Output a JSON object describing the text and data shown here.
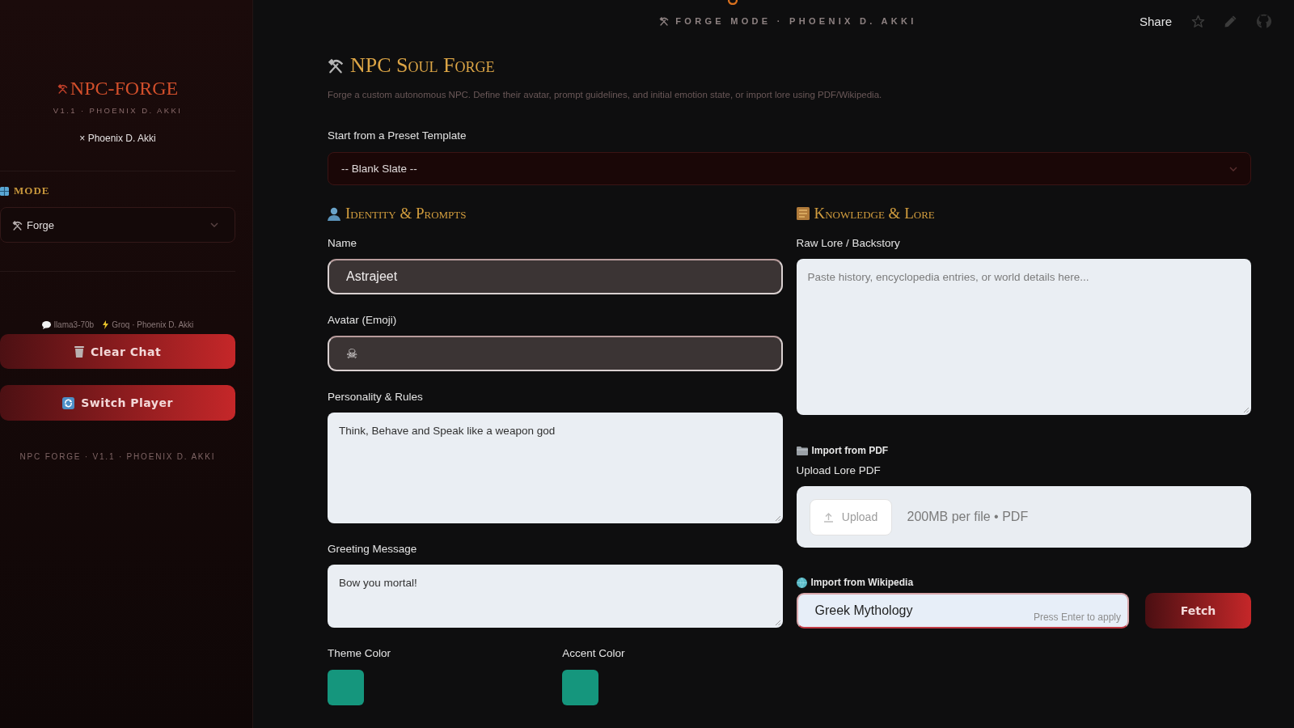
{
  "sidebar": {
    "logo": "NPC-FORGE",
    "version": "V1.1 · PHOENIX D. AKKI",
    "author": "× Phoenix D. Akki",
    "mode": {
      "label": "MODE",
      "value": "Forge"
    },
    "engine_note": {
      "model": "llama3-70b",
      "provider": "Groq · Phoenix D. Akki"
    },
    "buttons": [
      {
        "label": "Clear Chat"
      },
      {
        "label": "Switch Player"
      }
    ],
    "footer": "NPC FORGE · V1.1 · PHOENIX D. AKKI"
  },
  "header": {
    "banner": "FORGE MODE · PHOENIX D. AKKI",
    "share": "Share"
  },
  "forge": {
    "title": "NPC Soul Forge",
    "description": "Forge a custom autonomous NPC. Define their avatar, prompt guidelines, and initial emotion state, or import lore using PDF/Wikipedia.",
    "preset": {
      "label": "Start from a Preset Template",
      "value": "-- Blank Slate --"
    },
    "identity": {
      "heading": "Identity & Prompts",
      "fields": [
        {
          "kind": "input",
          "label": "Name",
          "value": "Astrajeet"
        },
        {
          "kind": "input",
          "label": "Avatar (Emoji)",
          "value": "☠"
        },
        {
          "kind": "textarea",
          "label": "Personality & Rules",
          "value": "Think, Behave and Speak like a weapon god"
        },
        {
          "kind": "textarea",
          "label": "Greeting Message",
          "value": "Bow you mortal!"
        }
      ],
      "colors": [
        {
          "label": "Theme Color",
          "color": "#15967d"
        },
        {
          "label": "Accent Color",
          "color": "#15967d"
        }
      ]
    },
    "knowledge": {
      "heading": "Knowledge & Lore",
      "lore": {
        "label": "Raw Lore / Backstory",
        "placeholder": "Paste history, encyclopedia entries, or world details here..."
      },
      "pdf": {
        "heading": "Import from PDF",
        "label": "Upload Lore PDF",
        "button": "Upload",
        "limits": "200MB per file • PDF"
      },
      "wikipedia": {
        "heading": "Import from Wikipedia",
        "value": "Greek Mythology",
        "hint": "Press Enter to apply",
        "button": "Fetch"
      }
    }
  }
}
